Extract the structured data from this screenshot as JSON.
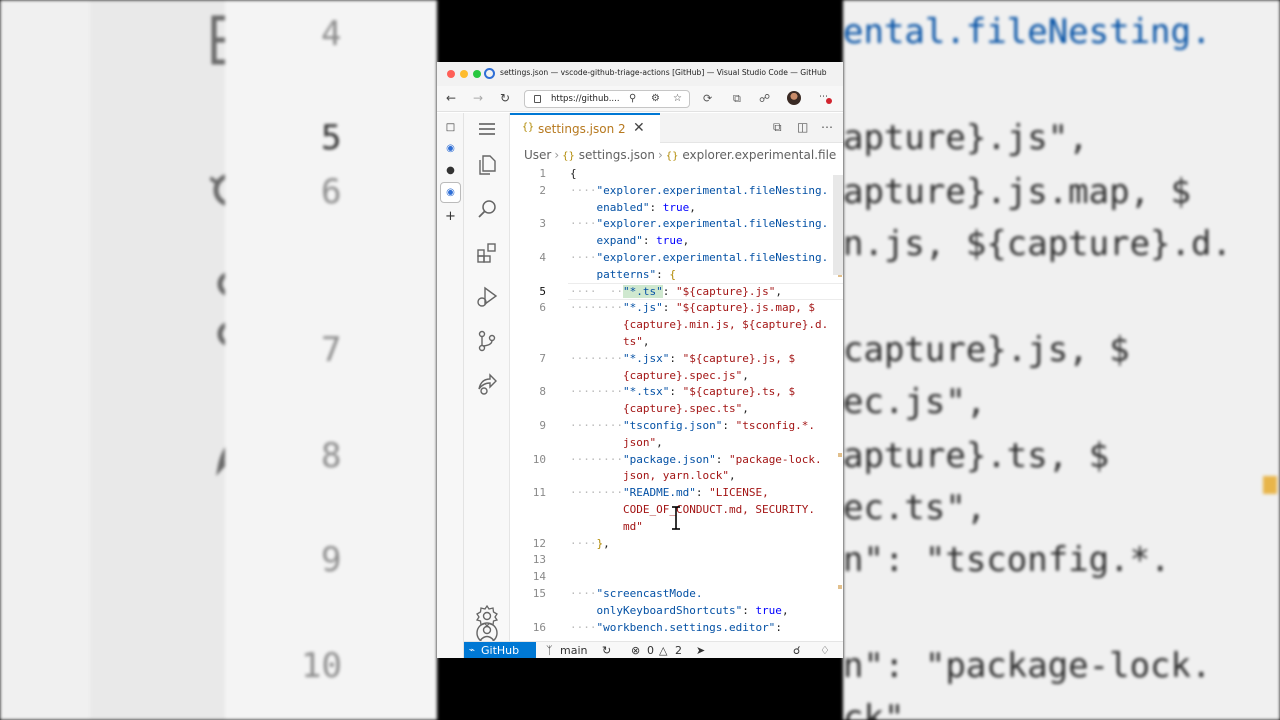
{
  "window": {
    "title": "settings.json — vscode-github-triage-actions [GitHub] — Visual Studio Code — GitHub"
  },
  "browser": {
    "url": "https://github...."
  },
  "editor": {
    "tab": {
      "label": "settings.json",
      "problem_count": "2"
    },
    "breadcrumb": {
      "root": "User",
      "file": "settings.json",
      "symbol": "explorer.experimental.file"
    }
  },
  "code_lines": [
    {
      "ln": "1",
      "segments": [
        [
          "p",
          "{"
        ]
      ]
    },
    {
      "ln": "2",
      "segments": [
        [
          "g",
          "····"
        ],
        [
          "k",
          "\"explorer.experimental.fileNesting."
        ]
      ]
    },
    {
      "ln": "",
      "segments": [
        [
          "k",
          "    enabled\""
        ],
        [
          "p",
          ": "
        ],
        [
          "b",
          "true"
        ],
        [
          "p",
          ","
        ]
      ]
    },
    {
      "ln": "3",
      "segments": [
        [
          "g",
          "····"
        ],
        [
          "k",
          "\"explorer.experimental.fileNesting."
        ]
      ]
    },
    {
      "ln": "",
      "segments": [
        [
          "k",
          "    expand\""
        ],
        [
          "p",
          ": "
        ],
        [
          "b",
          "true"
        ],
        [
          "p",
          ","
        ]
      ]
    },
    {
      "ln": "4",
      "segments": [
        [
          "g",
          "····"
        ],
        [
          "k",
          "\"explorer.experimental.fileNesting."
        ]
      ]
    },
    {
      "ln": "",
      "segments": [
        [
          "k",
          "    patterns\""
        ],
        [
          "p",
          ": "
        ],
        [
          "yb",
          "{"
        ]
      ]
    },
    {
      "ln": "5",
      "cur": true,
      "segments": [
        [
          "g",
          "····  ··"
        ],
        [
          "hl",
          "\"*.ts\""
        ],
        [
          "p",
          ": "
        ],
        [
          "s",
          "\"${capture}.js\""
        ],
        [
          "p",
          ","
        ]
      ]
    },
    {
      "ln": "6",
      "segments": [
        [
          "g",
          "········"
        ],
        [
          "k",
          "\"*.js\""
        ],
        [
          "p",
          ": "
        ],
        [
          "s",
          "\"${capture}.js.map, $"
        ]
      ]
    },
    {
      "ln": "",
      "segments": [
        [
          "s",
          "        {capture}.min.js, ${capture}.d."
        ]
      ]
    },
    {
      "ln": "",
      "segments": [
        [
          "s",
          "        ts\""
        ],
        [
          "p",
          ","
        ]
      ]
    },
    {
      "ln": "7",
      "segments": [
        [
          "g",
          "········"
        ],
        [
          "k",
          "\"*.jsx\""
        ],
        [
          "p",
          ": "
        ],
        [
          "s",
          "\"${capture}.js, $"
        ]
      ]
    },
    {
      "ln": "",
      "segments": [
        [
          "s",
          "        {capture}.spec.js\""
        ],
        [
          "p",
          ","
        ]
      ]
    },
    {
      "ln": "8",
      "segments": [
        [
          "g",
          "········"
        ],
        [
          "k",
          "\"*.tsx\""
        ],
        [
          "p",
          ": "
        ],
        [
          "s",
          "\"${capture}.ts, $"
        ]
      ]
    },
    {
      "ln": "",
      "segments": [
        [
          "s",
          "        {capture}.spec.ts\""
        ],
        [
          "p",
          ","
        ]
      ]
    },
    {
      "ln": "9",
      "segments": [
        [
          "g",
          "········"
        ],
        [
          "k",
          "\"tsconfig.json\""
        ],
        [
          "p",
          ": "
        ],
        [
          "s",
          "\"tsconfig.*."
        ]
      ]
    },
    {
      "ln": "",
      "segments": [
        [
          "s",
          "        json\""
        ],
        [
          "p",
          ","
        ]
      ]
    },
    {
      "ln": "10",
      "segments": [
        [
          "g",
          "········"
        ],
        [
          "k",
          "\"package.json\""
        ],
        [
          "p",
          ": "
        ],
        [
          "s",
          "\"package-lock."
        ]
      ]
    },
    {
      "ln": "",
      "segments": [
        [
          "s",
          "        json, yarn.lock\""
        ],
        [
          "p",
          ","
        ]
      ]
    },
    {
      "ln": "11",
      "segments": [
        [
          "g",
          "········"
        ],
        [
          "k",
          "\"README.md\""
        ],
        [
          "p",
          ": "
        ],
        [
          "s",
          "\"LICENSE,"
        ]
      ]
    },
    {
      "ln": "",
      "segments": [
        [
          "s",
          "        CODE_OF_CONDUCT.md, SECURITY."
        ]
      ]
    },
    {
      "ln": "",
      "segments": [
        [
          "s",
          "        md\""
        ]
      ]
    },
    {
      "ln": "12",
      "segments": [
        [
          "g",
          "····"
        ],
        [
          "yb",
          "}"
        ],
        [
          "p",
          ","
        ]
      ]
    },
    {
      "ln": "13",
      "segments": []
    },
    {
      "ln": "14",
      "segments": []
    },
    {
      "ln": "15",
      "segments": [
        [
          "g",
          "····"
        ],
        [
          "k",
          "\"screencastMode."
        ]
      ]
    },
    {
      "ln": "",
      "segments": [
        [
          "k",
          "    onlyKeyboardShortcuts\""
        ],
        [
          "p",
          ": "
        ],
        [
          "b",
          "true"
        ],
        [
          "p",
          ","
        ]
      ]
    },
    {
      "ln": "16",
      "segments": [
        [
          "g",
          "····"
        ],
        [
          "k",
          "\"workbench.settings.editor\""
        ],
        [
          "p",
          ":"
        ]
      ]
    }
  ],
  "statusbar": {
    "remote_label": "GitHub",
    "branch": "main",
    "errors": "0",
    "warnings": "2"
  },
  "background": {
    "left_line_numbers": [
      "4",
      "5",
      "6",
      "7",
      "8",
      "9",
      "10"
    ],
    "current_line_number": "5",
    "right_lines": [
      "ental.fileNesting.",
      "apture}.js\",",
      "apture}.js.map, $",
      "n.js, ${capture}.d.",
      "capture}.js, $",
      "ec.js\",",
      "apture}.ts, $",
      "ec.ts\",",
      "n\": \"tsconfig.*.",
      "n\": \"package-lock.",
      "ck\""
    ]
  },
  "colors": {
    "accent": "#0078d4",
    "string": "#a31515",
    "key": "#0451a5",
    "boolean": "#0000ff",
    "warning": "#b7791f"
  }
}
